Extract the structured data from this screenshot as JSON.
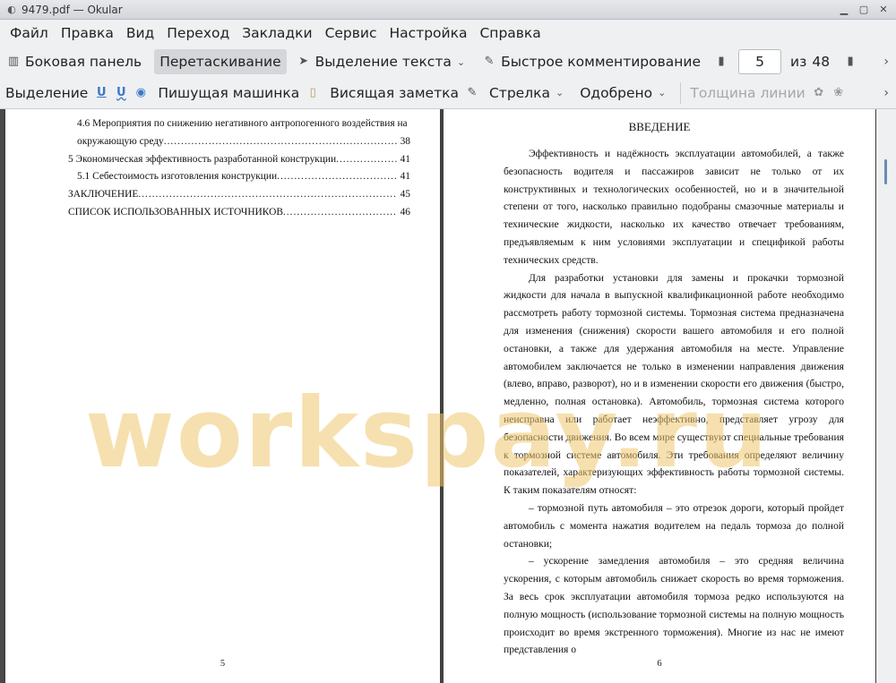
{
  "window": {
    "title": "9479.pdf  — Okular"
  },
  "menubar": [
    "Файл",
    "Правка",
    "Вид",
    "Переход",
    "Закладки",
    "Сервис",
    "Настройка",
    "Справка"
  ],
  "toolbar1": {
    "sidebar": "Боковая панель",
    "drag": "Перетаскивание",
    "select_text": "Выделение текста",
    "quick_comment": "Быстрое комментирование",
    "page_current": "5",
    "page_of": "из",
    "page_total": "48"
  },
  "toolbar2": {
    "highlight": "Выделение",
    "typewriter": "Пишущая машинка",
    "note": "Висящая заметка",
    "arrow": "Стрелка",
    "approved": "Одобрено",
    "line_width": "Толщина линии"
  },
  "page5": {
    "toc": [
      {
        "text": "4.6 Мероприятия по снижению негативного антропогенного воздействия на",
        "num": "",
        "indent": 1,
        "dots": false
      },
      {
        "text": "окружающую среду",
        "num": "38",
        "indent": 1,
        "dots": true
      },
      {
        "text": "5 Экономическая эффективность разработанной конструкции",
        "num": "41",
        "indent": 0,
        "dots": true
      },
      {
        "text": "5.1 Себестоимость изготовления конструкции",
        "num": "41",
        "indent": 1,
        "dots": true
      },
      {
        "text": "ЗАКЛЮЧЕНИЕ",
        "num": "45",
        "indent": 0,
        "dots": true
      },
      {
        "text": "СПИСОК ИСПОЛЬЗОВАННЫХ ИСТОЧНИКОВ",
        "num": "46",
        "indent": 0,
        "dots": true
      }
    ],
    "page_number": "5"
  },
  "page6": {
    "heading": "ВВЕДЕНИЕ",
    "paragraphs": [
      "Эффективность и надёжность эксплуатации автомобилей, а также безопасность водителя и пассажиров зависит не только от их конструктивных и технологических особенностей, но и в значительной степени от того, насколько правильно подобраны смазочные материалы и технические жидкости, насколько их качество отвечает требованиям, предъявляемым к ним условиями эксплуатации и спецификой работы технических средств.",
      "Для разработки установки для замены и прокачки тормозной жидкости для начала в выпускной квалификационной работе необходимо рассмотреть работу тормозной системы. Тормозная система предназначена для изменения (снижения) скорости вашего автомобиля и его полной остановки, а также для удержания автомобиля на месте. Управление автомобилем заключается не только в изменении направления движения (влево, вправо, разворот), но и в изменении скорости его движения (быстро, медленно, полная остановка). Автомобиль, тормозная система которого неисправна или работает неэффективно, представляет угрозу для безопасности движения. Во всем мире существуют специальные требования к тормозной системе автомобиля. Эти требования определяют величину показателей, характеризующих эффективность работы тормозной системы. К таким показателям относят:",
      "– тормозной путь автомобиля – это отрезок дороги, который пройдет автомобиль с момента нажатия водителем на педаль тормоза до полной остановки;",
      "– ускорение замедления автомобиля – это средняя величина ускорения, с которым автомобиль снижает скорость во время торможения. За весь срок эксплуатации автомобиля тормоза редко используются на полную мощность (использование тормозной системы на полную мощность происходит во время экстренного торможения). Многие из нас не имеют представления о"
    ],
    "page_number": "6"
  },
  "watermark": "workspay.ru"
}
